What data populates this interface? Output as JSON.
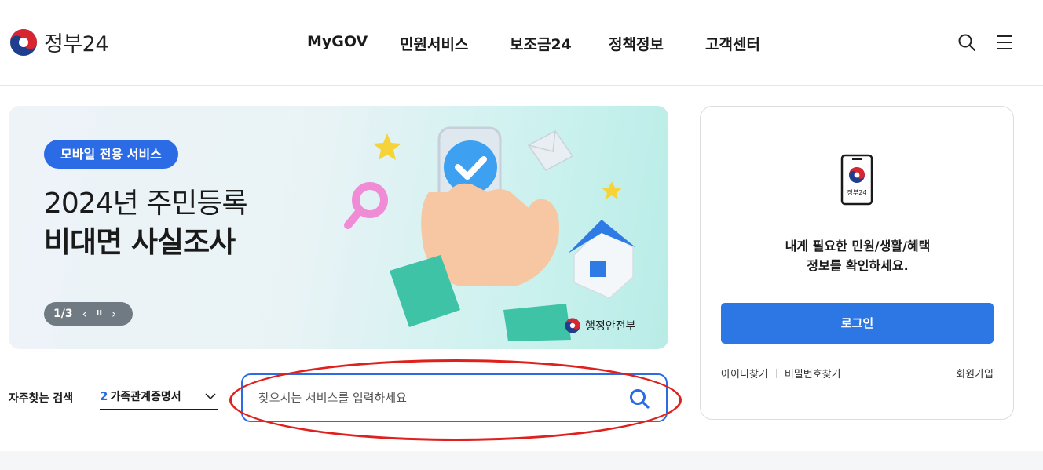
{
  "header": {
    "logo_text": "정부24",
    "nav": [
      "MyGOV",
      "민원서비스",
      "보조금24",
      "정책정보",
      "고객센터"
    ],
    "icons": [
      "search-icon",
      "hamburger-menu-icon"
    ]
  },
  "banner": {
    "badge": "모바일 전용 서비스",
    "title_line1": "2024년 주민등록",
    "title_line2": "비대면 사실조사",
    "pager": "1/3",
    "prev_icon": "‹",
    "pause_icon": "II",
    "next_icon": "›",
    "ministry": "행정안전부"
  },
  "login": {
    "phone_label": "정부24",
    "message_line1": "내게 필요한 민원/생활/혜택",
    "message_line2": "정보를 확인하세요.",
    "button": "로그인",
    "find_id": "아이디찾기",
    "find_pw": "비밀번호찾기",
    "signup": "회원가입"
  },
  "search": {
    "frequent_label": "자주찾는 검색",
    "frequent_rank": "2",
    "frequent_value": "가족관계증명서",
    "placeholder": "찾으시는 서비스를 입력하세요"
  },
  "colors": {
    "brand_blue": "#2b6be6",
    "login_button": "#2d77e4",
    "annotation_red": "#e0201d",
    "emblem_red": "#d7262f",
    "emblem_blue": "#1f3e8e"
  }
}
